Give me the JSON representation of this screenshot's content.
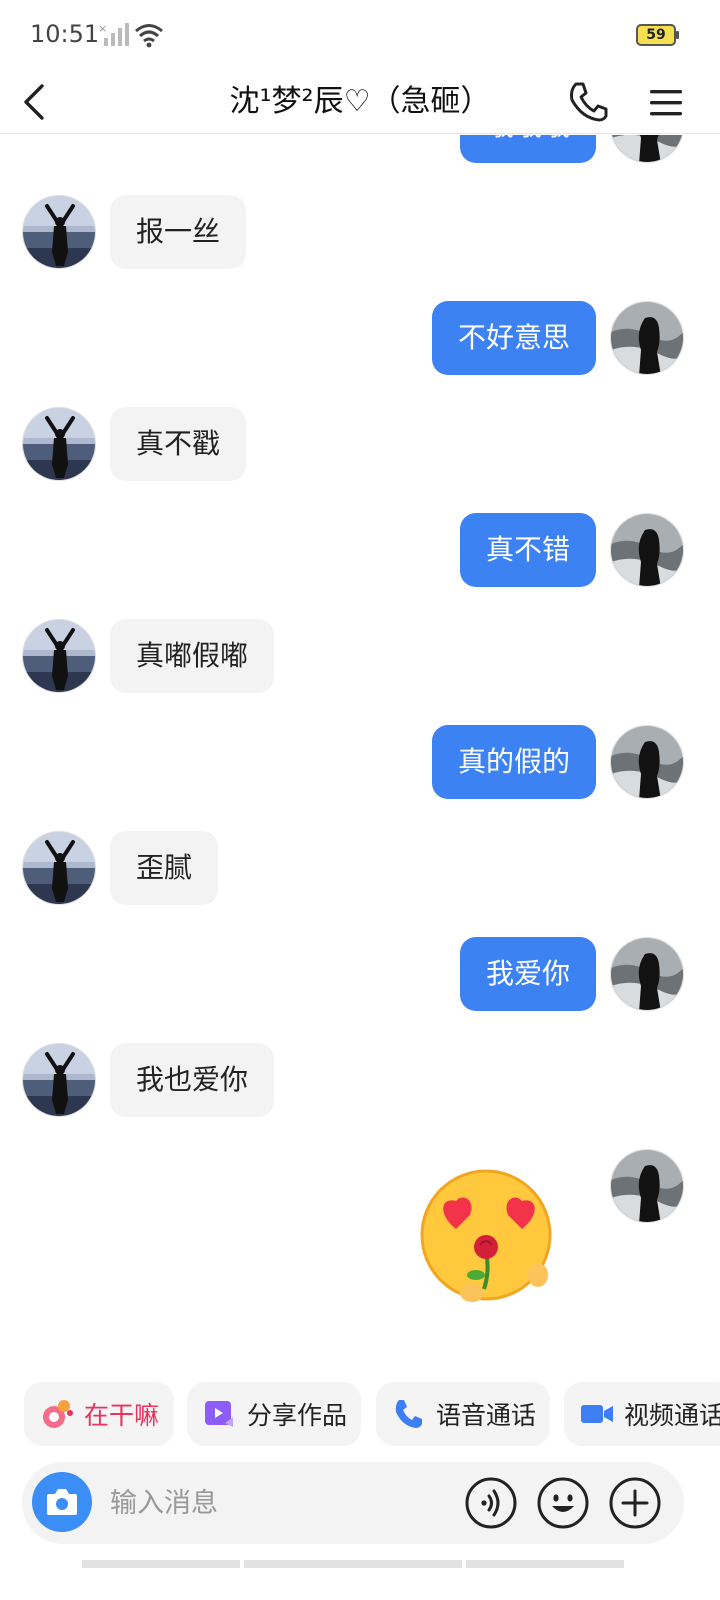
{
  "status_bar": {
    "time": "10:51",
    "battery": "59"
  },
  "header": {
    "title": "沈¹梦²辰♡（急砸）"
  },
  "messages": [
    {
      "side": "out",
      "text": "哦哦哦"
    },
    {
      "side": "in",
      "text": "报一丝"
    },
    {
      "side": "out",
      "text": "不好意思"
    },
    {
      "side": "in",
      "text": "真不戳"
    },
    {
      "side": "out",
      "text": "真不错"
    },
    {
      "side": "in",
      "text": "真嘟假嘟"
    },
    {
      "side": "out",
      "text": "真的假的"
    },
    {
      "side": "in",
      "text": "歪腻"
    },
    {
      "side": "out",
      "text": "我爱你"
    },
    {
      "side": "in",
      "text": "我也爱你"
    }
  ],
  "quick_actions": [
    {
      "label": "在干嘛",
      "icon": "sticker-face-icon"
    },
    {
      "label": "分享作品",
      "icon": "share-video-icon"
    },
    {
      "label": "语音通话",
      "icon": "phone-icon"
    },
    {
      "label": "视频通话",
      "icon": "video-camera-icon"
    }
  ],
  "input": {
    "placeholder": "输入消息"
  },
  "colors": {
    "accent": "#3d82f2",
    "incoming_bubble": "#f3f3f3",
    "pink": "#e8325e"
  }
}
